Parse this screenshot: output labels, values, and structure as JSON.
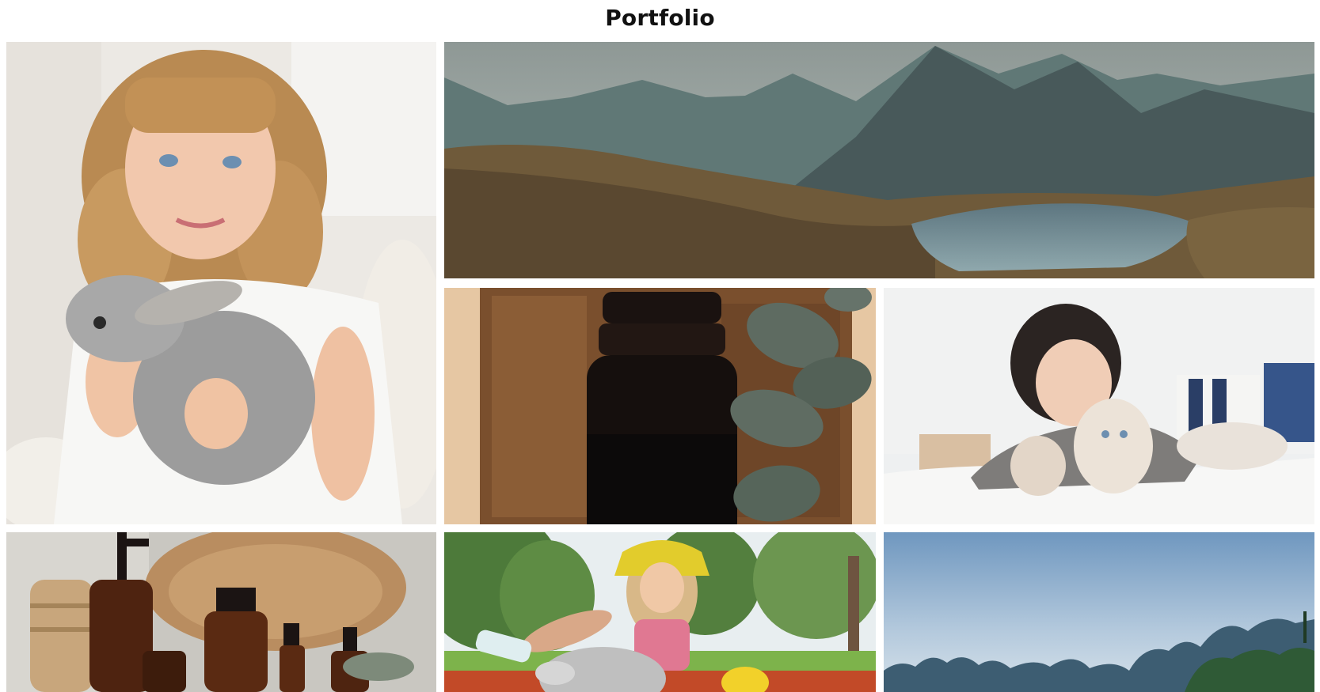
{
  "page": {
    "title": "Portfolio"
  },
  "gallery": {
    "items": [
      {
        "id": "girl-with-rabbit",
        "icon": "photo-girl-rabbit"
      },
      {
        "id": "mountain-lake",
        "icon": "photo-mountain-lake"
      },
      {
        "id": "dark-jar-eucalyptus",
        "icon": "photo-jar-eucalyptus"
      },
      {
        "id": "woman-with-cats",
        "icon": "photo-woman-cats"
      },
      {
        "id": "amber-bottles",
        "icon": "photo-amber-bottles"
      },
      {
        "id": "woman-with-dog",
        "icon": "photo-woman-dog"
      },
      {
        "id": "karst-mountains",
        "icon": "photo-karst-mountains"
      }
    ]
  },
  "colors": {
    "background": "#ffffff",
    "title": "#111111"
  }
}
